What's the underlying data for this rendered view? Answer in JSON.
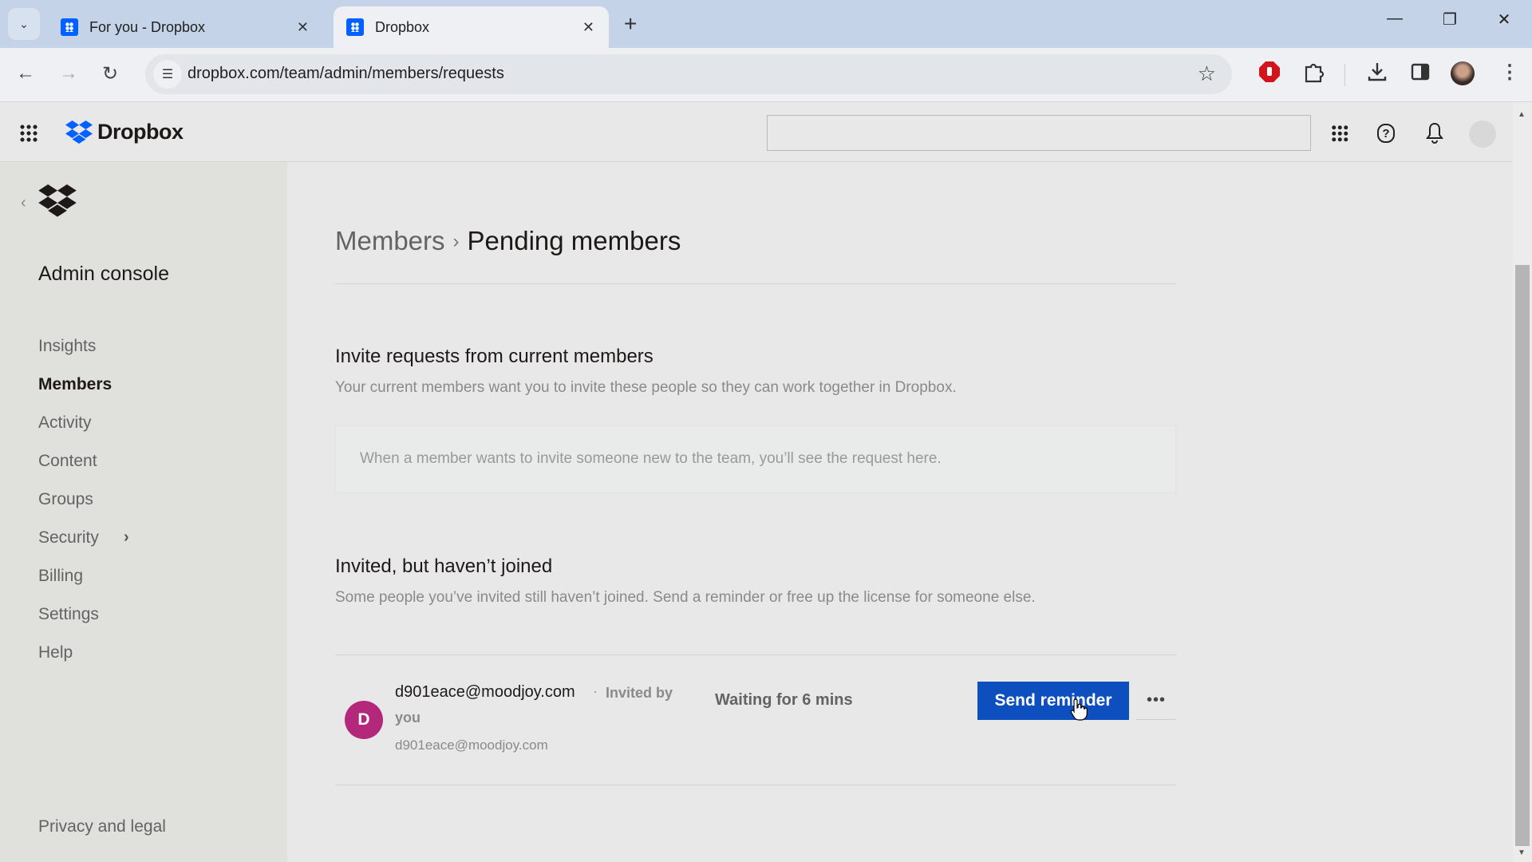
{
  "browser": {
    "tabs": [
      {
        "label": "For you - Dropbox",
        "active": false
      },
      {
        "label": "Dropbox",
        "active": true
      }
    ],
    "url": "dropbox.com/team/admin/members/requests",
    "new_tab_label": "+",
    "close_glyph": "✕",
    "window_controls": {
      "minimize": "—",
      "restore": "❐",
      "close": "✕"
    }
  },
  "header": {
    "brand": "Dropbox",
    "search_placeholder": ""
  },
  "sidebar": {
    "title": "Admin console",
    "items": [
      {
        "label": "Insights",
        "active": false
      },
      {
        "label": "Members",
        "active": true
      },
      {
        "label": "Activity",
        "active": false
      },
      {
        "label": "Content",
        "active": false
      },
      {
        "label": "Groups",
        "active": false
      },
      {
        "label": "Security",
        "active": false,
        "has_submenu": true
      },
      {
        "label": "Billing",
        "active": false
      },
      {
        "label": "Settings",
        "active": false
      },
      {
        "label": "Help",
        "active": false
      }
    ],
    "footer_link": "Privacy and legal"
  },
  "main": {
    "breadcrumb": {
      "parent": "Members",
      "separator": "›",
      "current": "Pending members"
    },
    "invite_requests": {
      "title": "Invite requests from current members",
      "description": "Your current members want you to invite these people so they can work together in Dropbox.",
      "empty_message": "When a member wants to invite someone new to the team, you’ll see the request here."
    },
    "invited": {
      "title": "Invited, but haven’t joined",
      "description": "Some people you’ve invited still haven’t joined. Send a reminder or free up the license for someone else.",
      "rows": [
        {
          "avatar_letter": "D",
          "avatar_color": "#b4287c",
          "email": "d901eace@moodjoy.com",
          "separator": "·",
          "invited_by_label": "Invited by",
          "invited_by": "you",
          "sub_email": "d901eace@moodjoy.com",
          "status": "Waiting for 6 mins",
          "action_label": "Send reminder",
          "more_label": "•••"
        }
      ]
    }
  },
  "colors": {
    "accent": "#0d4fbf",
    "brand_blue": "#0061fe"
  }
}
